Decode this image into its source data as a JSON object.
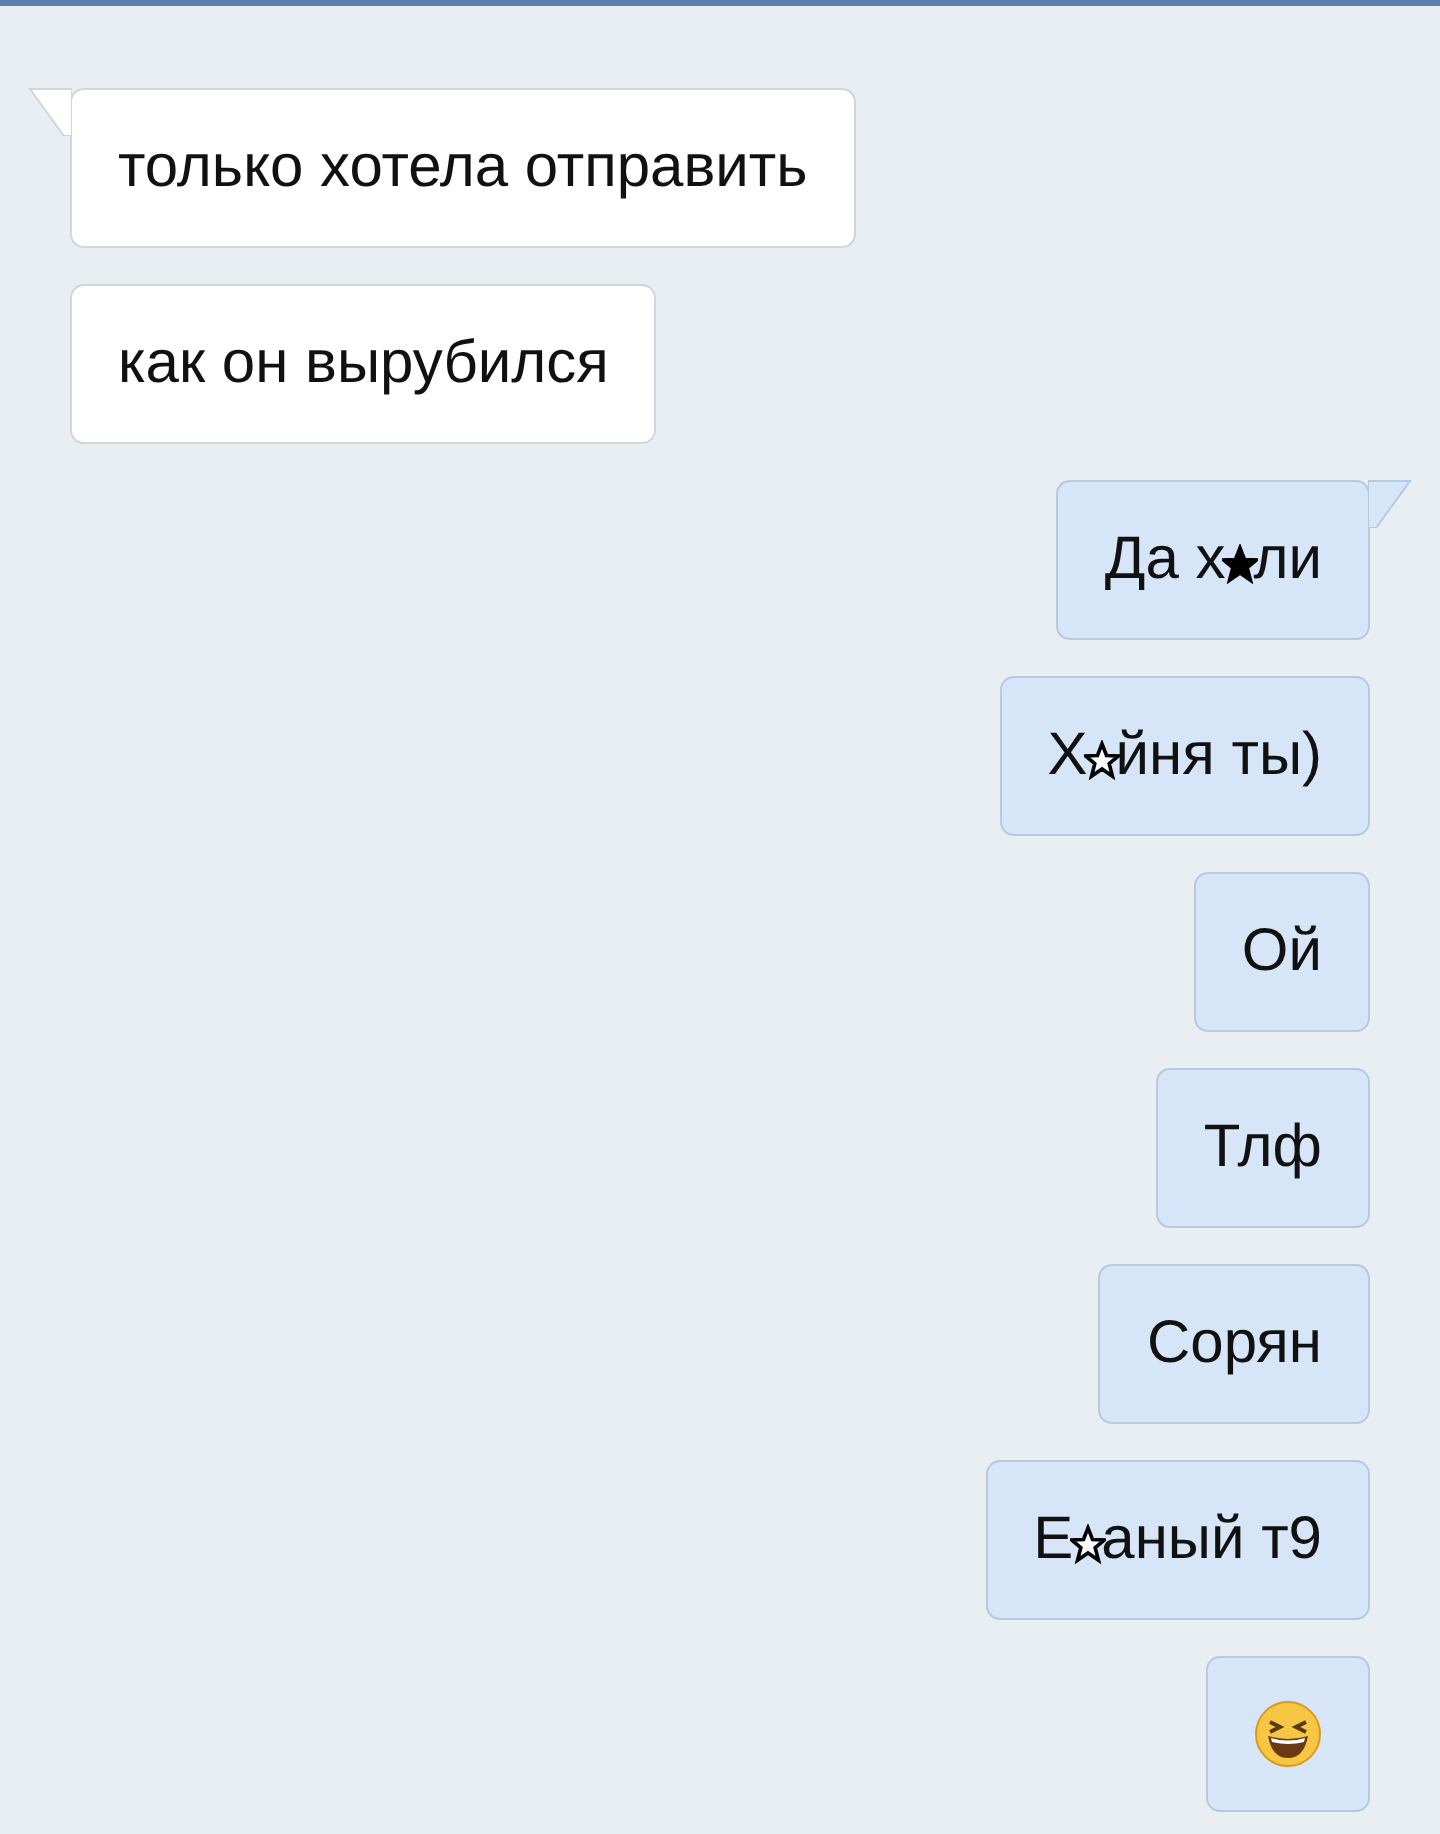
{
  "messages": [
    {
      "outgoing": false,
      "tail": true,
      "parts": [
        {
          "kind": "text",
          "text": "только хотела отправить"
        }
      ]
    },
    {
      "outgoing": false,
      "tail": false,
      "parts": [
        {
          "kind": "text",
          "text": "как он вырубился"
        }
      ]
    },
    {
      "outgoing": true,
      "tail": true,
      "parts": [
        {
          "kind": "text",
          "text": "Да х"
        },
        {
          "kind": "star",
          "filled": true
        },
        {
          "kind": "text",
          "text": "ли"
        }
      ]
    },
    {
      "outgoing": true,
      "tail": false,
      "parts": [
        {
          "kind": "text",
          "text": "Х"
        },
        {
          "kind": "star",
          "filled": false
        },
        {
          "kind": "text",
          "text": "йня ты)"
        }
      ]
    },
    {
      "outgoing": true,
      "tail": false,
      "parts": [
        {
          "kind": "text",
          "text": "Ой"
        }
      ]
    },
    {
      "outgoing": true,
      "tail": false,
      "parts": [
        {
          "kind": "text",
          "text": "Тлф"
        }
      ]
    },
    {
      "outgoing": true,
      "tail": false,
      "parts": [
        {
          "kind": "text",
          "text": "Сорян"
        }
      ]
    },
    {
      "outgoing": true,
      "tail": false,
      "parts": [
        {
          "kind": "text",
          "text": "Е"
        },
        {
          "kind": "star",
          "filled": false
        },
        {
          "kind": "text",
          "text": "аный т9"
        }
      ]
    },
    {
      "outgoing": true,
      "tail": false,
      "parts": [
        {
          "kind": "emoji"
        }
      ]
    }
  ]
}
